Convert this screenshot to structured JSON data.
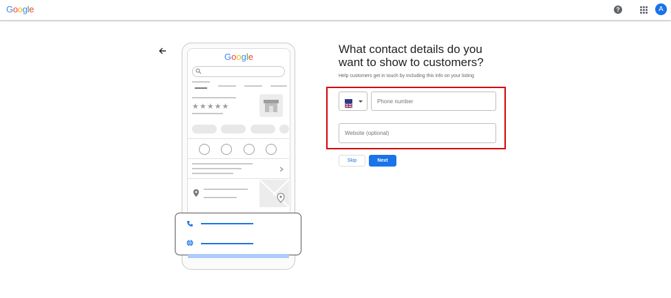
{
  "header": {
    "logo_letters": [
      "G",
      "o",
      "o",
      "g",
      "l",
      "e"
    ],
    "logo_colors": [
      "#4285f4",
      "#ea4335",
      "#fbbc05",
      "#4285f4",
      "#34a853",
      "#ea4335"
    ],
    "help_icon": "help-circle-icon",
    "apps_icon": "apps-grid-icon",
    "avatar_initial": "A",
    "avatar_color": "#1a73e8"
  },
  "illustration": {
    "logo_text": "Google",
    "rating_stars": "★★★★★"
  },
  "form": {
    "heading": "What contact details do you want to show to customers?",
    "subtext": "Help customers get in touch by including this info on your listing",
    "country_flag": "uk-flag-icon",
    "phone_placeholder": "Phone number",
    "website_placeholder": "Website (optional)",
    "skip_label": "Skip",
    "next_label": "Next",
    "accent_color": "#1a73e8",
    "highlight_color": "#d50000"
  }
}
